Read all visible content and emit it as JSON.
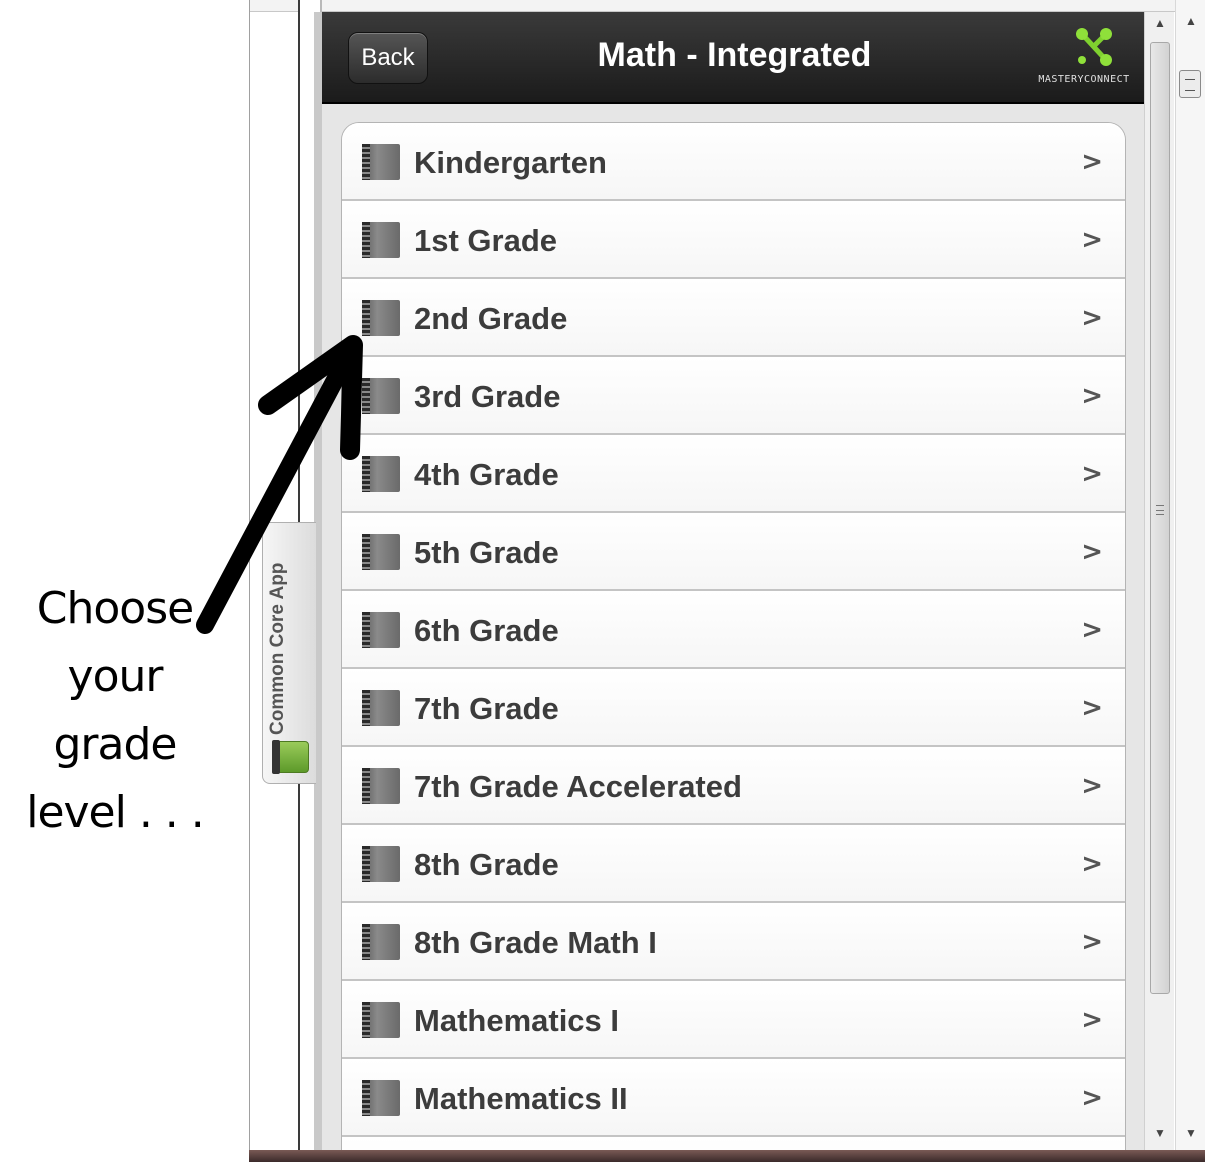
{
  "annotation": {
    "lines": [
      "Choose",
      "your",
      "grade",
      "level . . ."
    ]
  },
  "header": {
    "back_label": "Back",
    "title": "Math - Integrated",
    "logo_text": "MASTERYCONNECT"
  },
  "side_tab": {
    "label": "Common Core App"
  },
  "grades": [
    "Kindergarten",
    "1st Grade",
    "2nd Grade",
    "3rd Grade",
    "4th Grade",
    "5th Grade",
    "6th Grade",
    "7th Grade",
    "7th Grade Accelerated",
    "8th Grade",
    "8th Grade Math I",
    "Mathematics I",
    "Mathematics II"
  ],
  "colors": {
    "header_bg": "#1b1b1b",
    "logo_green": "#7fd12f",
    "row_text": "#3c3c3c"
  },
  "icons": {
    "row_icon": "book-icon",
    "chevron": "chevron-right-icon",
    "logo": "masteryconnect-logo-icon"
  }
}
